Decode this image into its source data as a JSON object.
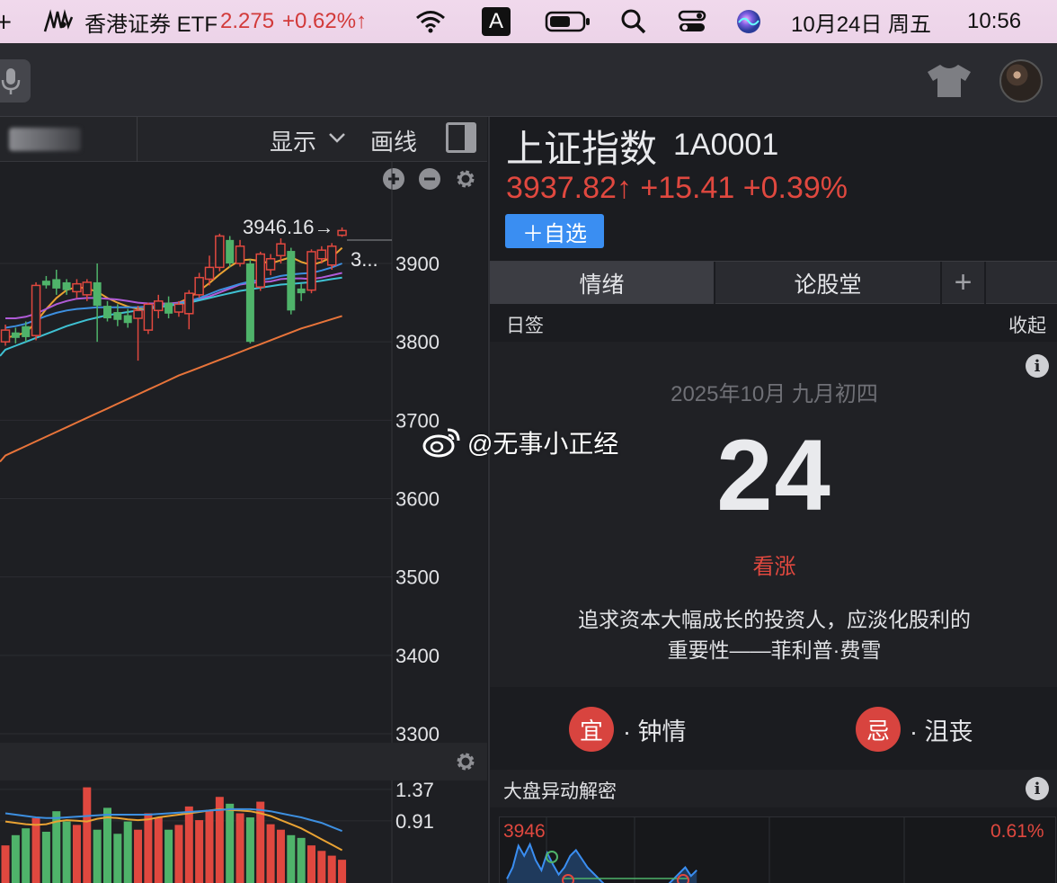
{
  "menubar": {
    "ticker_name": "香港证券 ETF",
    "ticker_price": "2.275",
    "ticker_change": "+0.62%↑",
    "input_method": "A",
    "date": "10月24日 周五",
    "time": "10:56"
  },
  "toolbar": {
    "display_label": "显示",
    "draw_label": "画线"
  },
  "price_axis": {
    "labels": [
      "3900",
      "3800",
      "3700",
      "3600",
      "3500",
      "3400",
      "3300"
    ],
    "high_marker": "3946.16→",
    "last_marker": "3..."
  },
  "indicator_axis": {
    "labels": [
      "1.37",
      "0.91"
    ]
  },
  "stock": {
    "name": "上证指数",
    "code": "1A0001",
    "price": "3937.82↑",
    "change": "+15.41",
    "change_pct": "+0.39%",
    "watch_button": "＋自选"
  },
  "tabs": [
    {
      "label": "情绪",
      "active": true
    },
    {
      "label": "论股堂",
      "active": false
    },
    {
      "label": "+",
      "active": false
    },
    {
      "label": "",
      "active": false
    }
  ],
  "daily": {
    "title": "日签",
    "collapse_label": "收起",
    "date_line": "2025年10月 九月初四",
    "day": "24",
    "mood": "看涨",
    "quote_line1": "追求资本大幅成长的投资人，应淡化股利的",
    "quote_line2": "重要性——菲利普·费雪",
    "good_badge": "宜",
    "good_text": "· 钟情",
    "bad_badge": "忌",
    "bad_text": "· 沮丧"
  },
  "market": {
    "title": "大盘异动解密",
    "mini_price": "3946",
    "mini_pct": "0.61%"
  },
  "watermark": "@无事小正经",
  "colors": {
    "up": "#e0483f",
    "down": "#4fb36a",
    "accent_blue": "#3a8ef2"
  },
  "chart_data": {
    "type": "candlestick",
    "ylim": [
      3300,
      3950
    ],
    "candles": [
      {
        "o": 3800,
        "c": 3815,
        "h": 3822,
        "l": 3795
      },
      {
        "o": 3812,
        "c": 3805,
        "h": 3818,
        "l": 3798
      },
      {
        "o": 3820,
        "c": 3806,
        "h": 3826,
        "l": 3800
      },
      {
        "o": 3808,
        "c": 3872,
        "h": 3876,
        "l": 3802
      },
      {
        "o": 3878,
        "c": 3872,
        "h": 3884,
        "l": 3868
      },
      {
        "o": 3880,
        "c": 3868,
        "h": 3892,
        "l": 3860
      },
      {
        "o": 3876,
        "c": 3866,
        "h": 3880,
        "l": 3860
      },
      {
        "o": 3864,
        "c": 3874,
        "h": 3880,
        "l": 3856
      },
      {
        "o": 3860,
        "c": 3876,
        "h": 3880,
        "l": 3852
      },
      {
        "o": 3876,
        "c": 3846,
        "h": 3900,
        "l": 3800
      },
      {
        "o": 3846,
        "c": 3830,
        "h": 3852,
        "l": 3826
      },
      {
        "o": 3838,
        "c": 3828,
        "h": 3848,
        "l": 3820
      },
      {
        "o": 3834,
        "c": 3824,
        "h": 3842,
        "l": 3818
      },
      {
        "o": 3830,
        "c": 3840,
        "h": 3846,
        "l": 3776
      },
      {
        "o": 3815,
        "c": 3848,
        "h": 3850,
        "l": 3810
      },
      {
        "o": 3840,
        "c": 3852,
        "h": 3860,
        "l": 3830
      },
      {
        "o": 3850,
        "c": 3836,
        "h": 3858,
        "l": 3830
      },
      {
        "o": 3838,
        "c": 3848,
        "h": 3852,
        "l": 3832
      },
      {
        "o": 3836,
        "c": 3862,
        "h": 3866,
        "l": 3816
      },
      {
        "o": 3860,
        "c": 3882,
        "h": 3888,
        "l": 3856
      },
      {
        "o": 3880,
        "c": 3895,
        "h": 3910,
        "l": 3872
      },
      {
        "o": 3895,
        "c": 3935,
        "h": 3938,
        "l": 3890
      },
      {
        "o": 3930,
        "c": 3900,
        "h": 3935,
        "l": 3895
      },
      {
        "o": 3900,
        "c": 3922,
        "h": 3930,
        "l": 3896
      },
      {
        "o": 3900,
        "c": 3800,
        "h": 3905,
        "l": 3798
      },
      {
        "o": 3870,
        "c": 3912,
        "h": 3915,
        "l": 3865
      },
      {
        "o": 3892,
        "c": 3906,
        "h": 3912,
        "l": 3885
      },
      {
        "o": 3910,
        "c": 3925,
        "h": 3932,
        "l": 3900
      },
      {
        "o": 3916,
        "c": 3840,
        "h": 3920,
        "l": 3835
      },
      {
        "o": 3868,
        "c": 3862,
        "h": 3874,
        "l": 3852
      },
      {
        "o": 3866,
        "c": 3915,
        "h": 3918,
        "l": 3862
      },
      {
        "o": 3906,
        "c": 3917,
        "h": 3922,
        "l": 3900
      },
      {
        "o": 3898,
        "c": 3922,
        "h": 3926,
        "l": 3892
      },
      {
        "o": 3936,
        "c": 3942,
        "h": 3946,
        "l": 3934
      }
    ],
    "ma": [
      {
        "color": "#e9a233",
        "values": [
          3805,
          3808,
          3812,
          3825,
          3842,
          3856,
          3866,
          3870,
          3868,
          3864,
          3856,
          3850,
          3845,
          3842,
          3842,
          3845,
          3848,
          3850,
          3856,
          3865,
          3875,
          3886,
          3896,
          3904,
          3905,
          3903,
          3900,
          3904,
          3908,
          3902,
          3898,
          3902,
          3908,
          3920
        ]
      },
      {
        "color": "#b05bd8",
        "values": [
          3830,
          3830,
          3832,
          3836,
          3842,
          3848,
          3852,
          3855,
          3856,
          3856,
          3855,
          3854,
          3852,
          3850,
          3849,
          3849,
          3849,
          3850,
          3852,
          3855,
          3858,
          3863,
          3868,
          3873,
          3875,
          3876,
          3877,
          3880,
          3881,
          3881,
          3880,
          3882,
          3885,
          3888
        ]
      },
      {
        "color": "#3d8fe0",
        "values": [
          3818,
          3820,
          3823,
          3828,
          3833,
          3837,
          3840,
          3842,
          3843,
          3844,
          3844,
          3844,
          3844,
          3844,
          3845,
          3846,
          3847,
          3849,
          3852,
          3856,
          3861,
          3866,
          3870,
          3874,
          3877,
          3879,
          3881,
          3884,
          3886,
          3887,
          3888,
          3891,
          3895,
          3900
        ]
      },
      {
        "color": "#3fc1d3",
        "values": [
          3790,
          3795,
          3800,
          3805,
          3810,
          3815,
          3820,
          3824,
          3828,
          3831,
          3834,
          3836,
          3838,
          3840,
          3842,
          3844,
          3846,
          3848,
          3850,
          3853,
          3856,
          3859,
          3862,
          3865,
          3867,
          3869,
          3871,
          3873,
          3874,
          3875,
          3876,
          3878,
          3880,
          3882
        ]
      },
      {
        "color": "#e8743a",
        "values": [
          3655,
          3661,
          3667,
          3673,
          3679,
          3685,
          3691,
          3697,
          3703,
          3709,
          3715,
          3721,
          3727,
          3733,
          3739,
          3745,
          3751,
          3757,
          3762,
          3767,
          3772,
          3777,
          3782,
          3787,
          3792,
          3797,
          3802,
          3807,
          3812,
          3817,
          3821,
          3825,
          3829,
          3833
        ]
      }
    ],
    "indicator": {
      "ylim": [
        0,
        1.5
      ],
      "bars": [
        0.55,
        0.7,
        0.8,
        0.95,
        0.75,
        1.05,
        0.9,
        0.85,
        1.4,
        0.78,
        1.1,
        0.72,
        0.9,
        0.78,
        1.02,
        0.96,
        0.78,
        0.85,
        1.12,
        0.92,
        1.06,
        1.26,
        1.16,
        1.02,
        0.96,
        1.19,
        0.86,
        0.78,
        0.7,
        0.66,
        0.55,
        0.47,
        0.4,
        0.34
      ],
      "lines": [
        {
          "color": "#e9a233",
          "values": [
            0.9,
            0.88,
            0.86,
            0.85,
            0.86,
            0.9,
            0.92,
            0.91,
            0.9,
            0.94,
            0.96,
            0.95,
            0.93,
            0.92,
            0.93,
            0.96,
            0.98,
            1.0,
            1.02,
            1.04,
            1.06,
            1.08,
            1.07,
            1.06,
            1.05,
            1.02,
            0.98,
            0.92,
            0.86,
            0.8,
            0.72,
            0.64,
            0.56,
            0.48
          ]
        },
        {
          "color": "#3d8fe0",
          "values": [
            1.02,
            1.0,
            0.98,
            0.96,
            0.95,
            0.95,
            0.96,
            0.97,
            0.98,
            0.99,
            1.0,
            1.0,
            1.0,
            1.0,
            1.0,
            1.01,
            1.02,
            1.03,
            1.04,
            1.05,
            1.06,
            1.07,
            1.08,
            1.08,
            1.08,
            1.07,
            1.05,
            1.02,
            0.99,
            0.96,
            0.92,
            0.88,
            0.82,
            0.76
          ]
        }
      ]
    },
    "mini": {
      "values": [
        3922,
        3930,
        3945,
        3938,
        3946,
        3935,
        3928,
        3940,
        3932,
        3925,
        3930,
        3938,
        3942,
        3936,
        3930,
        3926,
        3922,
        3918,
        3915,
        3912,
        3916,
        3914,
        3912,
        3913,
        3915,
        3912,
        3914,
        3916,
        3918,
        3922,
        3926,
        3930,
        3924,
        3928
      ]
    }
  }
}
